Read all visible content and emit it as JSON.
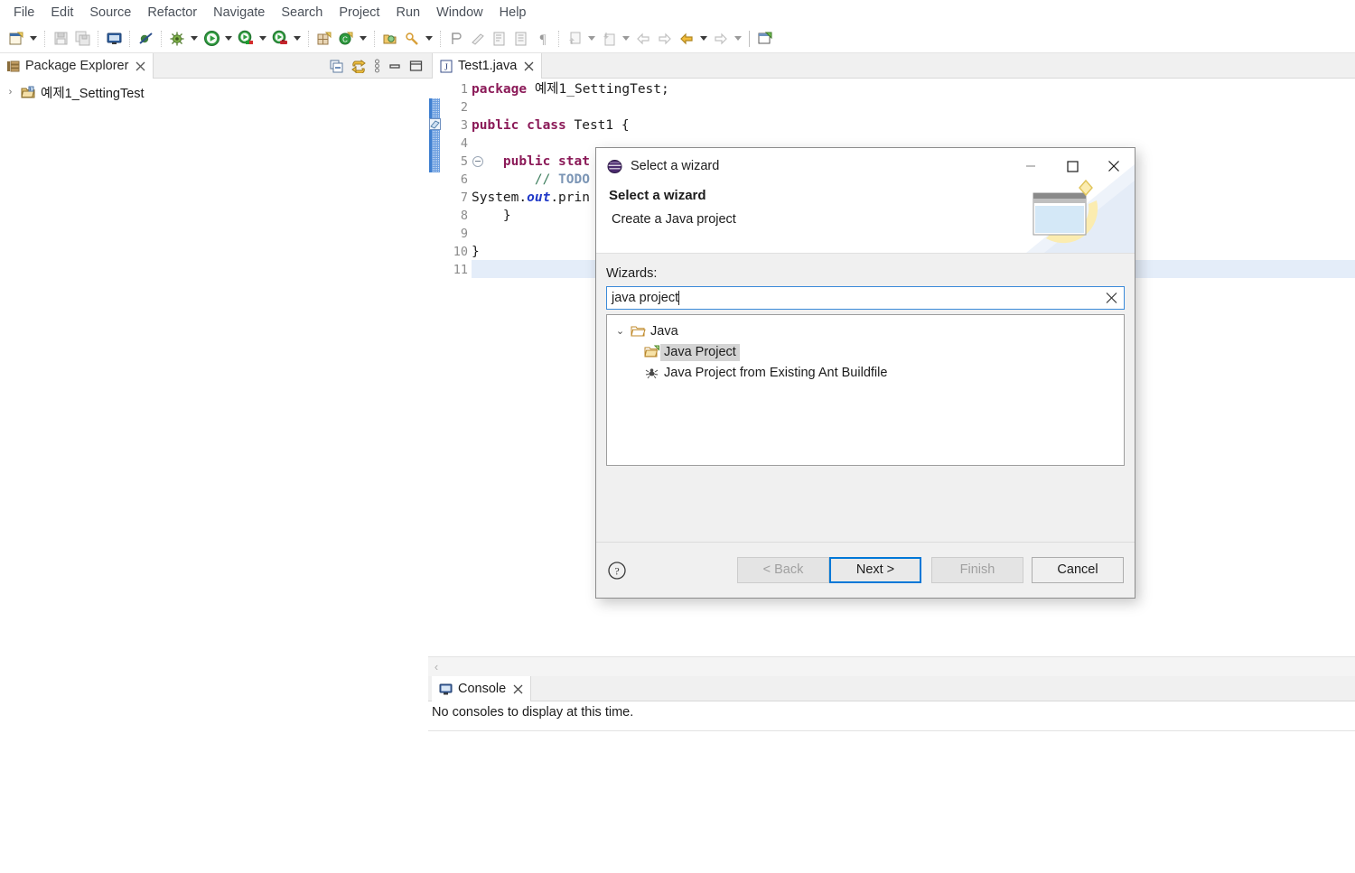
{
  "menubar": {
    "items": [
      {
        "label": "File"
      },
      {
        "label": "Edit"
      },
      {
        "label": "Source"
      },
      {
        "label": "Refactor"
      },
      {
        "label": "Navigate"
      },
      {
        "label": "Search"
      },
      {
        "label": "Project"
      },
      {
        "label": "Run"
      },
      {
        "label": "Window"
      },
      {
        "label": "Help"
      }
    ]
  },
  "toolbar": {
    "icons": [
      "new-wizard-icon",
      "save-icon",
      "save-all-icon",
      "new-java-console-icon",
      "skip-breakpoints-icon",
      "debug-icon",
      "run-icon",
      "coverage-icon",
      "run-last-tool-icon",
      "new-java-package-icon",
      "new-java-class-icon",
      "open-type-icon",
      "search-icon",
      "toggle-mark-occurrences-icon",
      "next-annotation-icon",
      "previous-annotation-icon",
      "show-whitespace-icon",
      "pin-editor-icon",
      "back-icon",
      "forward-icon",
      "previous-edit-icon",
      "next-edit-icon",
      "open-perspective-icon"
    ]
  },
  "package_explorer": {
    "tab_label": "Package Explorer",
    "tab_icon": "package-explorer-icon",
    "close_icon": "close-icon",
    "tools": [
      {
        "name": "collapse-all-icon"
      },
      {
        "name": "link-with-editor-icon"
      },
      {
        "name": "view-menu-icon"
      },
      {
        "name": "minimize-icon"
      },
      {
        "name": "maximize-icon"
      }
    ],
    "tree": [
      {
        "label": "예제1_SettingTest",
        "icon": "java-project-icon",
        "expanded": false,
        "twisty": "›"
      }
    ]
  },
  "editor": {
    "tab_label": "Test1.java",
    "tab_icon": "java-file-icon",
    "close_icon": "close-icon",
    "current_line": 11,
    "lines": [
      {
        "n": 1,
        "text": "package 예제1_SettingTest;"
      },
      {
        "n": 2,
        "text": ""
      },
      {
        "n": 3,
        "text": "public class Test1 {"
      },
      {
        "n": 4,
        "text": ""
      },
      {
        "n": 5,
        "text": "    public stat",
        "folded": true
      },
      {
        "n": 6,
        "text": "        // TODO"
      },
      {
        "n": 7,
        "text": "System.out.prin"
      },
      {
        "n": 8,
        "text": "    }"
      },
      {
        "n": 9,
        "text": ""
      },
      {
        "n": 10,
        "text": "}"
      },
      {
        "n": 11,
        "text": ""
      }
    ],
    "scroll_left_icon": "scroll-left-icon"
  },
  "console": {
    "tab_label": "Console",
    "tab_icon": "console-icon",
    "close_icon": "close-icon",
    "message": "No consoles to display at this time."
  },
  "dialog": {
    "title": "Select a wizard",
    "app_icon": "eclipse-icon",
    "minimize_icon": "minimize-icon",
    "maximize_icon": "maximize-icon",
    "close_icon": "close-icon",
    "banner_title": "Select a wizard",
    "banner_subtitle": "Create a Java project",
    "banner_icon": "wizard-banner-icon",
    "wizards_label": "Wizards:",
    "search": {
      "value": "java project",
      "clear_icon": "clear-icon",
      "focused": true
    },
    "tree": [
      {
        "label": "Java",
        "icon": "open-folder-icon",
        "level": 0,
        "twisty": "⌄",
        "selected": false
      },
      {
        "label": "Java Project",
        "icon": "java-project-wizard-icon",
        "level": 1,
        "selected": true
      },
      {
        "label": "Java Project from Existing Ant Buildfile",
        "icon": "ant-buildfile-icon",
        "level": 1,
        "selected": false
      }
    ],
    "help_icon": "help-icon",
    "buttons": [
      {
        "label": "< Back",
        "state": "disabled",
        "name": "back-button"
      },
      {
        "label": "Next >",
        "state": "focused",
        "name": "next-button"
      },
      {
        "label": "Finish",
        "state": "disabled",
        "name": "finish-button"
      },
      {
        "label": "Cancel",
        "state": "enabled",
        "name": "cancel-button"
      }
    ]
  },
  "colors": {
    "accent": "#0078d7",
    "keyword": "#8b1a58",
    "field": "#1f38c8",
    "todo": "#7b95b5",
    "current_line": "#e4edf9"
  }
}
